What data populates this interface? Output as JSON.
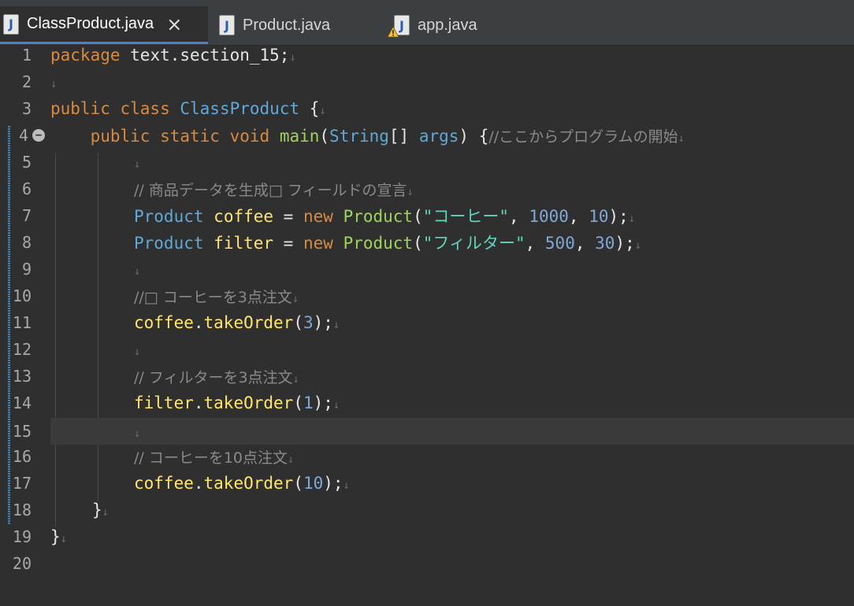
{
  "tabs": [
    {
      "label": "ClassProduct.java",
      "active": true,
      "close": "×",
      "icon": "java-file-icon"
    },
    {
      "label": "Product.java",
      "active": false,
      "icon": "java-file-icon"
    },
    {
      "label": "app.java",
      "active": false,
      "icon": "java-file-warning-icon"
    }
  ],
  "editor": {
    "line_numbers": [
      "1",
      "2",
      "3",
      "4",
      "5",
      "6",
      "7",
      "8",
      "9",
      "10",
      "11",
      "12",
      "13",
      "14",
      "15",
      "16",
      "17",
      "18",
      "19",
      "20"
    ],
    "current_line": "15",
    "eol_marker": "↓",
    "colors": {
      "keyword": "#d98a3f",
      "type": "#5fa8d8",
      "variable": "#ffe56b",
      "method": "#9fd45a",
      "string": "#5ed5c0",
      "number": "#7fa8d8",
      "comment": "#8a8a8a"
    },
    "tokens": {
      "l1_kw": "package",
      "l1_rest": " text.section_15;",
      "l3_kw": "public class",
      "l3_cls": "ClassProduct",
      "l3_rest": " {",
      "l4_kw": "public static void",
      "l4_meth": "main",
      "l4_p1": "(",
      "l4_type": "String",
      "l4_p2": "[] ",
      "l4_args": "args",
      "l4_p3": ") {",
      "l4_cmt": "//ここからプログラムの開始",
      "l6_cmt": "// 商品データを生成□ フィールドの宣言",
      "l7_type": "Product",
      "l7_var": "coffee",
      "l7_eq": " = ",
      "l7_new": "new",
      "l7_ctor": "Product",
      "l7_p1": "(",
      "l7_str": "\"コーヒー\"",
      "l7_c1": ", ",
      "l7_n1": "1000",
      "l7_c2": ", ",
      "l7_n2": "10",
      "l7_end": ");",
      "l8_type": "Product",
      "l8_var": "filter",
      "l8_eq": " = ",
      "l8_new": "new",
      "l8_ctor": "Product",
      "l8_p1": "(",
      "l8_str": "\"フィルター\"",
      "l8_c1": ", ",
      "l8_n1": "500",
      "l8_c2": ", ",
      "l8_n2": "30",
      "l8_end": ");",
      "l10_cmt": "//□ コーヒーを3点注文",
      "l11_obj": "coffee",
      "l11_dot": ".",
      "l11_call": "takeOrder",
      "l11_p1": "(",
      "l11_n": "3",
      "l11_end": ");",
      "l13_cmt": "// フィルターを3点注文",
      "l14_obj": "filter",
      "l14_dot": ".",
      "l14_call": "takeOrder",
      "l14_p1": "(",
      "l14_n": "1",
      "l14_end": ");",
      "l16_cmt": "// コーヒーを10点注文",
      "l17_obj": "coffee",
      "l17_dot": ".",
      "l17_call": "takeOrder",
      "l17_p1": "(",
      "l17_n": "10",
      "l17_end": ");",
      "l18": "}",
      "l19": "}"
    }
  }
}
